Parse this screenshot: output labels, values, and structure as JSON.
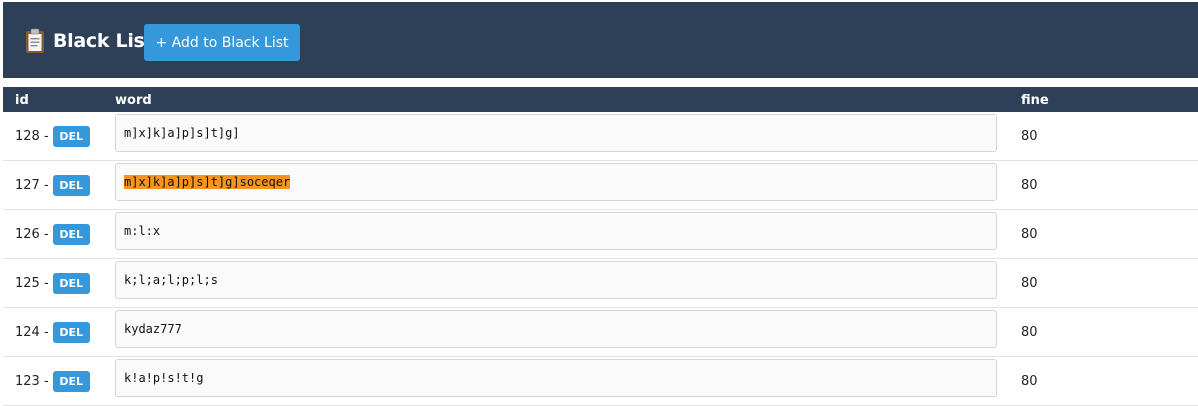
{
  "header": {
    "title": "Black List",
    "title_icon": "clipboard-icon",
    "add_button_label": "+ Add to Black List",
    "background": "#2e4057",
    "accent": "#3498db"
  },
  "table": {
    "columns": {
      "id": "id",
      "word": "word",
      "fine": "fine"
    },
    "delete_label": "DEL",
    "selection_color": "#f7941d",
    "rows": [
      {
        "id": "128 -",
        "word": "m]x]k]a]p]s]t]g]",
        "fine": "80",
        "selected": false
      },
      {
        "id": "127 -",
        "word": "m]x]k]a]p]s]t]g]soceqer",
        "fine": "80",
        "selected": true
      },
      {
        "id": "126 -",
        "word": "m:l:x",
        "fine": "80",
        "selected": false
      },
      {
        "id": "125 -",
        "word": "k;l;a;l;p;l;s",
        "fine": "80",
        "selected": false
      },
      {
        "id": "124 -",
        "word": "kydaz777",
        "fine": "80",
        "selected": false
      },
      {
        "id": "123 -",
        "word": "k!a!p!s!t!g",
        "fine": "80",
        "selected": false
      }
    ]
  }
}
